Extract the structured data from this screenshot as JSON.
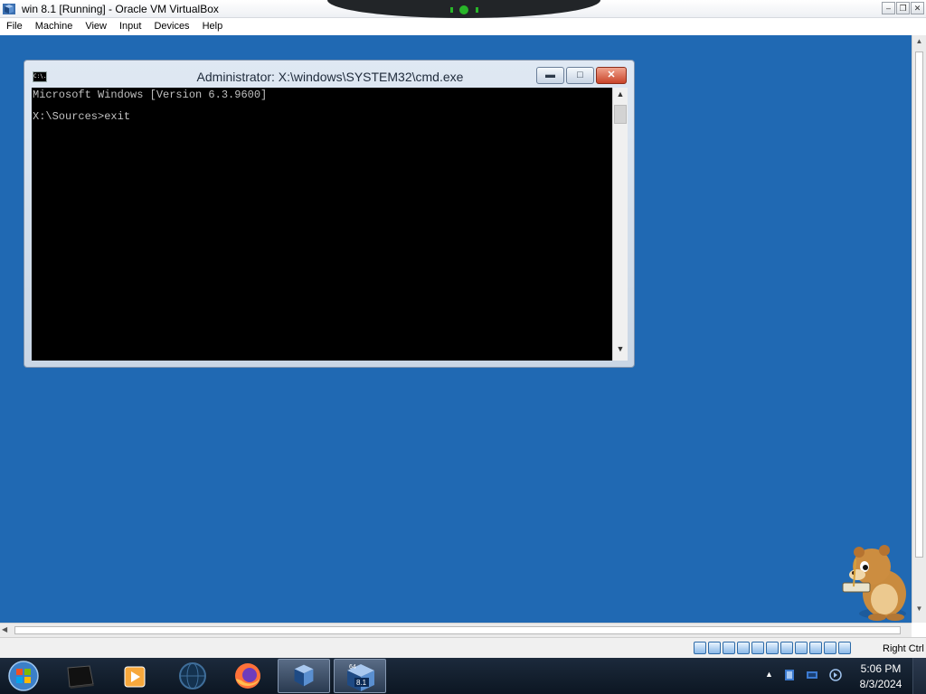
{
  "host": {
    "title": "win 8.1 [Running] - Oracle VM VirtualBox",
    "window_controls": [
      "minimize",
      "restore",
      "close"
    ],
    "menu": [
      "File",
      "Machine",
      "View",
      "Input",
      "Devices",
      "Help"
    ],
    "status_host_key": "Right Ctrl",
    "status_icons": [
      "hard-disk-icon",
      "optical-drive-icon",
      "floppy-icon",
      "network-icon",
      "usb-icon",
      "shared-folder-icon",
      "display-icon",
      "recording-icon",
      "cpu-icon",
      "mouse-integration-icon",
      "keyboard-icon"
    ]
  },
  "cmd": {
    "title": "Administrator: X:\\windows\\SYSTEM32\\cmd.exe",
    "icon_text": "C:\\.",
    "lines": "Microsoft Windows [Version 6.3.9600]\n\nX:\\Sources>exit"
  },
  "taskbar": {
    "items": [
      "terminal-app-icon",
      "media-player-icon",
      "globe-app-icon",
      "firefox-icon",
      "virtualbox-icon",
      "windows-81-vm-icon"
    ],
    "vm_badge": "8.1",
    "vm_badge_top": "64",
    "clock_time": "5:06 PM",
    "clock_date": "8/3/2024"
  },
  "colors": {
    "desktop": "#2069b3",
    "console_bg": "#000000",
    "console_text": "#c0c0c0",
    "taskbar": "#142031"
  }
}
